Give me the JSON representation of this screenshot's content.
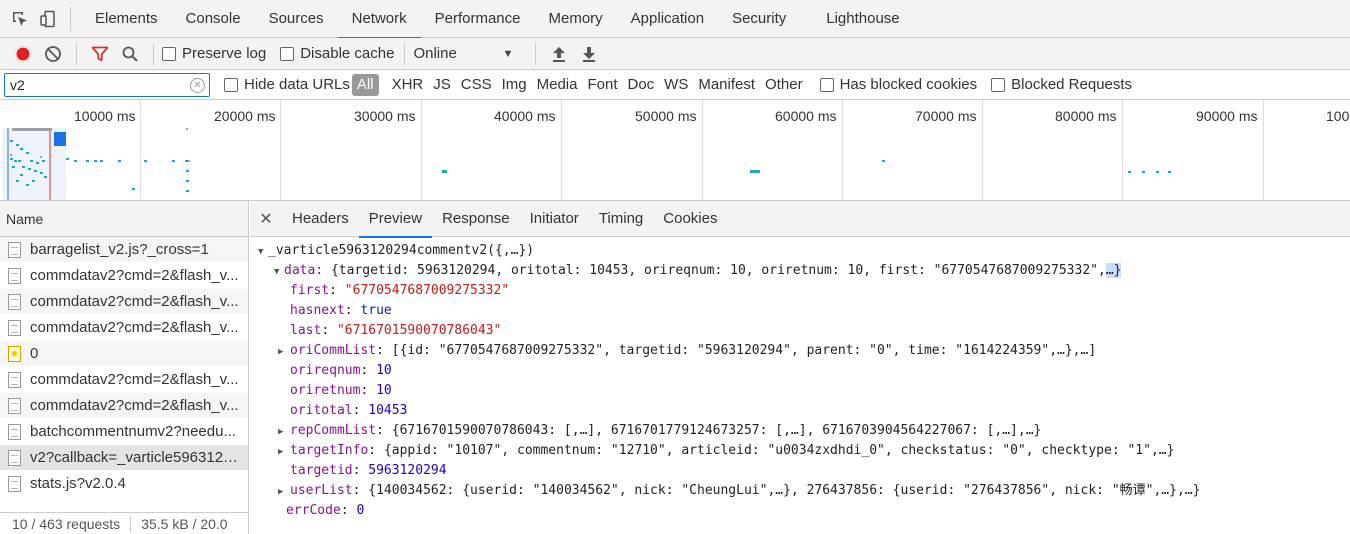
{
  "devtools": {
    "tabs": [
      "Elements",
      "Console",
      "Sources",
      "Network",
      "Performance",
      "Memory",
      "Application",
      "Security",
      "Lighthouse"
    ],
    "active_tab": "Network"
  },
  "toolbar": {
    "preserve_log": "Preserve log",
    "disable_cache": "Disable cache",
    "throttling": "Online"
  },
  "filter": {
    "value": "v2",
    "hide_data_urls": "Hide data URLs",
    "types": [
      "All",
      "XHR",
      "JS",
      "CSS",
      "Img",
      "Media",
      "Font",
      "Doc",
      "WS",
      "Manifest",
      "Other"
    ],
    "has_blocked_cookies": "Has blocked cookies",
    "blocked_requests": "Blocked Requests"
  },
  "overview": {
    "ticks": [
      "10000 ms",
      "20000 ms",
      "30000 ms",
      "40000 ms",
      "50000 ms",
      "60000 ms",
      "70000 ms",
      "80000 ms",
      "90000 ms",
      "100"
    ]
  },
  "requests": {
    "column_name": "Name",
    "items": [
      {
        "name": "barragelist_v2.js?_cross=1",
        "icon": "file-icon"
      },
      {
        "name": "commdatav2?cmd=2&flash_v...",
        "icon": "file-icon"
      },
      {
        "name": "commdatav2?cmd=2&flash_v...",
        "icon": "file-icon"
      },
      {
        "name": "commdatav2?cmd=2&flash_v...",
        "icon": "file-icon"
      },
      {
        "name": "0",
        "icon": "image-icon"
      },
      {
        "name": "commdatav2?cmd=2&flash_v...",
        "icon": "file-icon"
      },
      {
        "name": "commdatav2?cmd=2&flash_v...",
        "icon": "file-icon"
      },
      {
        "name": "batchcommentnumv2?needu...",
        "icon": "file-icon"
      },
      {
        "name": "v2?callback=_varticle5963120...",
        "icon": "file-icon"
      },
      {
        "name": "stats.js?v2.0.4",
        "icon": "file-icon"
      }
    ],
    "status_requests": "10 / 463 requests",
    "status_size": "35.5 kB / 20.0"
  },
  "detail": {
    "tabs": [
      "Headers",
      "Preview",
      "Response",
      "Initiator",
      "Timing",
      "Cookies"
    ],
    "active_tab": "Preview",
    "root": "_varticle5963120294commentv2({,…})",
    "data_key": "data:",
    "data_summary": " {targetid: 5963120294, oritotal: 10453, orireqnum: 10, oriretnum: 10, first: \"6770547687009275332\",",
    "data_summary_end": "…}",
    "props": [
      {
        "key": "first",
        "value": "\"6770547687009275332\"",
        "kind": "s",
        "expandable": false
      },
      {
        "key": "hasnext",
        "value": "true",
        "kind": "b",
        "expandable": false
      },
      {
        "key": "last",
        "value": "\"6716701590070786043\"",
        "kind": "s",
        "expandable": false
      },
      {
        "key": "oriCommList",
        "value": "[{id: \"6770547687009275332\", targetid: \"5963120294\", parent: \"0\", time: \"1614224359\",…},…]",
        "kind": "plain",
        "expandable": true
      },
      {
        "key": "orireqnum",
        "value": "10",
        "kind": "n",
        "expandable": false
      },
      {
        "key": "oriretnum",
        "value": "10",
        "kind": "n",
        "expandable": false
      },
      {
        "key": "oritotal",
        "value": "10453",
        "kind": "n",
        "expandable": false
      },
      {
        "key": "repCommList",
        "value": "{6716701590070786043: [,…], 6716701779124673257: [,…], 6716703904564227067: [,…],…}",
        "kind": "plain",
        "expandable": true
      },
      {
        "key": "targetInfo",
        "value": "{appid: \"10107\", commentnum: \"12710\", articleid: \"u0034zxdhdi_0\", checkstatus: \"0\", checktype: \"1\",…}",
        "kind": "plain",
        "expandable": true
      },
      {
        "key": "targetid",
        "value": "5963120294",
        "kind": "n",
        "expandable": false
      },
      {
        "key": "userList",
        "value": "{140034562: {userid: \"140034562\", nick: \"CheungLui\",…}, 276437856: {userid: \"276437856\", nick: \"畅谭\",…},…}",
        "kind": "plain",
        "expandable": true
      }
    ],
    "err_key": "errCode",
    "err_value": "0"
  },
  "colors": {
    "accent": "#1a73e8",
    "record": "#e51f1f",
    "filter_active": "#d93025",
    "waterfall": "#1fa9b4"
  }
}
